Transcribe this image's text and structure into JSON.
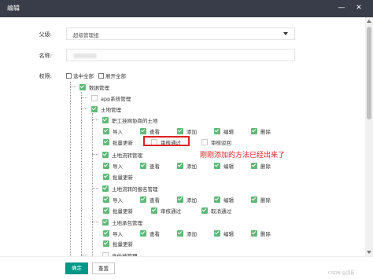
{
  "dialog": {
    "title": "编辑",
    "minimize_icon": "minus-icon",
    "close_icon": "close-icon"
  },
  "form": {
    "parent_label": "父级:",
    "parent_value": "超级管理组",
    "name_label": "名称:",
    "perm_label": "权限:",
    "select_all": "选中全部",
    "expand_all": "展开全部"
  },
  "tree": {
    "root": "数据管理",
    "app": "app系统管理",
    "land": "土地管理",
    "group1": "职工挂网协商的土地",
    "g1_row1": [
      "导入",
      "查看",
      "添加",
      "编辑",
      "删除"
    ],
    "g1_row2": [
      "批量更新",
      "审核通过",
      "审核驳回"
    ],
    "group2": "土地流转管理",
    "g2_row1": [
      "导入",
      "查看",
      "添加",
      "编辑",
      "删除"
    ],
    "g2_row2": [
      "批量更新"
    ],
    "group3": "土地流转的报名管理",
    "g3_row1": [
      "导入",
      "查看",
      "添加",
      "编辑",
      "删除"
    ],
    "g3_row2": [
      "批量更新",
      "审核通过",
      "取消通过"
    ],
    "group4": "土地承包管理",
    "g4_row1": [
      "导入",
      "查看",
      "添加",
      "编辑",
      "删除"
    ],
    "g4_row2": [
      "批量更新"
    ],
    "group5": "身份地管理"
  },
  "annotation": "刚刚添加的方法已经出来了",
  "footer": {
    "ok": "确定",
    "reset": "重置"
  },
  "watermark": "CSDN @凉臣",
  "colors": {
    "check_green": "#5fb878",
    "primary": "#009688",
    "highlight_red": "#e02020",
    "titlebar": "#393d49"
  }
}
